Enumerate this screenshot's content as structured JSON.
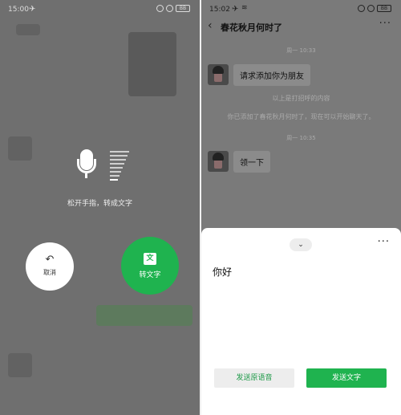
{
  "left": {
    "status": {
      "time": "15:00",
      "plane_icon": "airplane-icon",
      "battery": "BB"
    },
    "hint": "松开手指，转成文字",
    "cancel": {
      "icon": "undo-icon",
      "label": "取消"
    },
    "convert": {
      "icon": "text-icon",
      "icon_glyph": "文",
      "label": "转文字"
    },
    "colors": {
      "accent": "#1fb34f",
      "overlay": "#6f6f6f"
    }
  },
  "right": {
    "status": {
      "time": "15:02",
      "battery": "BB"
    },
    "nav": {
      "title": "春花秋月何时了",
      "back_icon": "chevron-left-icon",
      "more_icon": "more-icon"
    },
    "messages": [
      {
        "type": "timestamp",
        "text": "周一 10:33"
      },
      {
        "type": "text",
        "text": "请求添加你为朋友"
      },
      {
        "type": "system",
        "text": "以上是打招呼的内容"
      },
      {
        "type": "system",
        "text": "你已添加了春花秋月何时了，现在可以开始聊天了。"
      },
      {
        "type": "timestamp",
        "text": "周一 10:35"
      },
      {
        "type": "text",
        "text": "领一下"
      }
    ],
    "sheet": {
      "collapse_icon": "chevron-down-icon",
      "more_icon": "more-icon",
      "recognized_text": "你好",
      "send_voice_label": "发送原语音",
      "send_text_label": "发送文字"
    }
  }
}
